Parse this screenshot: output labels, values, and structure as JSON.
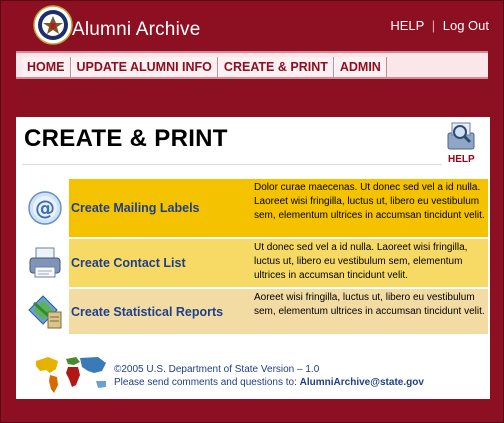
{
  "header": {
    "app_title": "Alumni Archive",
    "help_label": "HELP",
    "separator": "|",
    "logout_label": "Log Out"
  },
  "nav": {
    "items": [
      {
        "label": "HOME"
      },
      {
        "label": "UPDATE ALUMNI INFO"
      },
      {
        "label": "CREATE & PRINT"
      },
      {
        "label": "ADMIN"
      }
    ]
  },
  "main": {
    "page_title": "CREATE & PRINT",
    "help_icon_label": "HELP",
    "options": [
      {
        "icon": "at-sign-icon",
        "label": "Create Mailing Labels",
        "description": "Dolor curae maecenas. Ut donec sed vel a id nulla. Laoreet wisi fringilla, luctus ut, libero eu vestibulum sem, elementum ultrices in accumsan tincidunt velit."
      },
      {
        "icon": "printer-icon",
        "label": "Create Contact List",
        "description": "Ut donec sed vel a id nulla. Laoreet wisi fringilla, luctus ut, libero eu vestibulum sem, elementum ultrices in accumsan tincidunt velit."
      },
      {
        "icon": "statistics-report-icon",
        "label": "Create Statistical Reports",
        "description": "Aoreet wisi fringilla, luctus ut, libero eu vestibulum sem, elementum ultrices in accumsan tincidunt velit."
      }
    ]
  },
  "footer": {
    "copyright": "©2005 U.S. Department of State  Version – 1.0",
    "comments_text": "Please send comments and questions to:",
    "email": "AlumniArchive@state.gov"
  },
  "colors": {
    "brand_red": "#8c1022",
    "row1": "#f5c200",
    "row2": "#f7d966",
    "row3": "#f3dca4",
    "link_blue": "#1e3f8a"
  }
}
